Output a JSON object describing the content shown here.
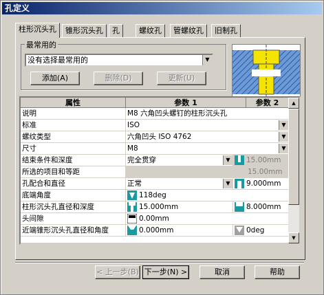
{
  "window": {
    "title": "孔定义"
  },
  "tabs": [
    {
      "label": "柱形沉头孔",
      "active": true
    },
    {
      "label": "锥形沉头孔"
    },
    {
      "label": "孔"
    },
    {
      "label": "螺纹孔"
    },
    {
      "label": "管螺纹孔"
    },
    {
      "label": "旧制孔"
    }
  ],
  "favorites": {
    "group_label": "最常用的",
    "select_value": "没有选择最常用的",
    "add_label": "添加(A)",
    "delete_label": "删除(D)",
    "update_label": "更新(U)"
  },
  "grid": {
    "headers": [
      "属性",
      "参数 1",
      "参数 2"
    ],
    "rows": [
      {
        "prop": "说明",
        "p1": "M8 六角凹头螺钉的柱形沉头孔",
        "p2": ""
      },
      {
        "prop": "标准",
        "p1": "ISO",
        "p2": ""
      },
      {
        "prop": "螺纹类型",
        "p1": "六角凹头 ISO 4762",
        "p2": ""
      },
      {
        "prop": "尺寸",
        "p1": "M8",
        "p2": ""
      },
      {
        "prop": "结束条件和深度",
        "p1": "完全贯穿",
        "p2": "15.00mm"
      },
      {
        "prop": "所选的项目和等距",
        "p1": "",
        "p2": "15.00mm"
      },
      {
        "prop": "孔配合和直径",
        "p1": "正常",
        "p2": "9.000mm"
      },
      {
        "prop": "底端角度",
        "p1": "118deg",
        "p2": ""
      },
      {
        "prop": "柱形沉头孔直径和深度",
        "p1": "15.000mm",
        "p2": "8.000mm"
      },
      {
        "prop": "头间隙",
        "p1": "0.00mm",
        "p2": ""
      },
      {
        "prop": "近端锥形沉头孔直径和角度",
        "p1": "0.000mm",
        "p2": "0deg"
      }
    ]
  },
  "footer": {
    "back_label": "< 上一步(B)",
    "next_label": "下一步(N) >",
    "cancel_label": "取消",
    "help_label": "帮助"
  },
  "colors": {
    "title_start": "#0a246a",
    "title_end": "#a6caf0",
    "icon_teal": "#1a9aa0"
  }
}
